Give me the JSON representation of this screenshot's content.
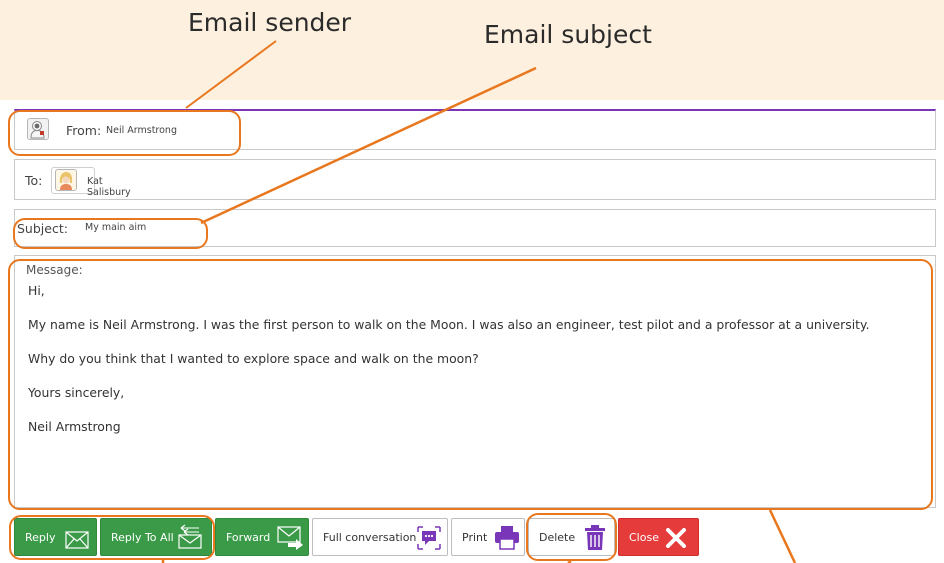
{
  "callouts": {
    "sender": "Email sender",
    "subject": "Email subject"
  },
  "email": {
    "from_label": "From:",
    "from_value": "Neil Armstrong",
    "to_label": "To:",
    "to_value": "Kat Salisbury",
    "subject_label": "Subject:",
    "subject_value": "My main aim",
    "message_label": "Message:",
    "message_paragraphs": [
      "Hi,",
      "My name is Neil Armstrong. I was the first person to walk on the Moon. I was also an engineer, test pilot and a professor at a university.",
      "Why do you think that I wanted to explore space and walk on the moon?",
      "Yours sincerely,",
      "Neil Armstrong"
    ]
  },
  "actions": {
    "reply": "Reply",
    "reply_all": "Reply To All",
    "forward": "Forward",
    "full_conversation": "Full conversation",
    "print": "Print",
    "delete": "Delete",
    "close": "Close"
  },
  "icons": {
    "from_avatar": "astronaut-avatar-icon",
    "to_avatar": "user-avatar-icon",
    "reply": "envelope-icon",
    "reply_all": "envelope-reply-all-icon",
    "forward": "envelope-forward-icon",
    "full_conversation": "speech-bubble-icon",
    "print": "printer-icon",
    "delete": "trash-icon",
    "close": "close-x-icon"
  },
  "colors": {
    "banner": "#fdf0de",
    "header_accent": "#7a36b8",
    "button_green": "#3a9a48",
    "button_red": "#e63b3b",
    "icon_purple": "#7a36b8",
    "highlight": "#e8771e"
  }
}
